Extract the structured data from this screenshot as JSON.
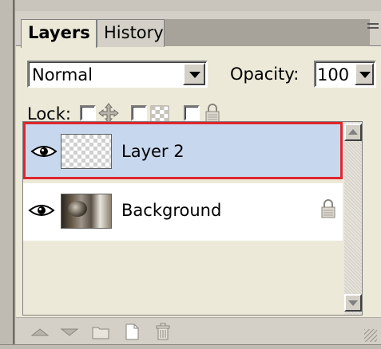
{
  "panel": {
    "tabs": [
      {
        "label": "Layers",
        "active": true
      },
      {
        "label": "History",
        "active": false
      }
    ],
    "menu_icon": "panel-menu-icon"
  },
  "blend_mode": {
    "selected": "Normal",
    "icon": "chevron-down-icon"
  },
  "opacity": {
    "label": "Opacity:",
    "value": "100",
    "icon": "chevron-down-icon"
  },
  "lock": {
    "label": "Lock:",
    "options": [
      {
        "icon": "lock-position-icon",
        "checked": false
      },
      {
        "icon": "lock-transparency-icon",
        "checked": false
      },
      {
        "icon": "lock-all-icon",
        "checked": false
      }
    ]
  },
  "layers": [
    {
      "name": "Layer 2",
      "selected": true,
      "visible": true,
      "locked": false,
      "thumbnail": "transparent-checkerboard"
    },
    {
      "name": "Background",
      "selected": false,
      "visible": true,
      "locked": true,
      "thumbnail": "photo"
    }
  ],
  "footer_icons": [
    "move-layer-up-icon",
    "move-layer-down-icon",
    "new-layer-set-icon",
    "new-layer-icon",
    "delete-layer-icon"
  ],
  "colors": {
    "selection_border": "#e0262e",
    "selection_fill": "#c7d7ee",
    "panel_bg": "#ece9d8"
  }
}
